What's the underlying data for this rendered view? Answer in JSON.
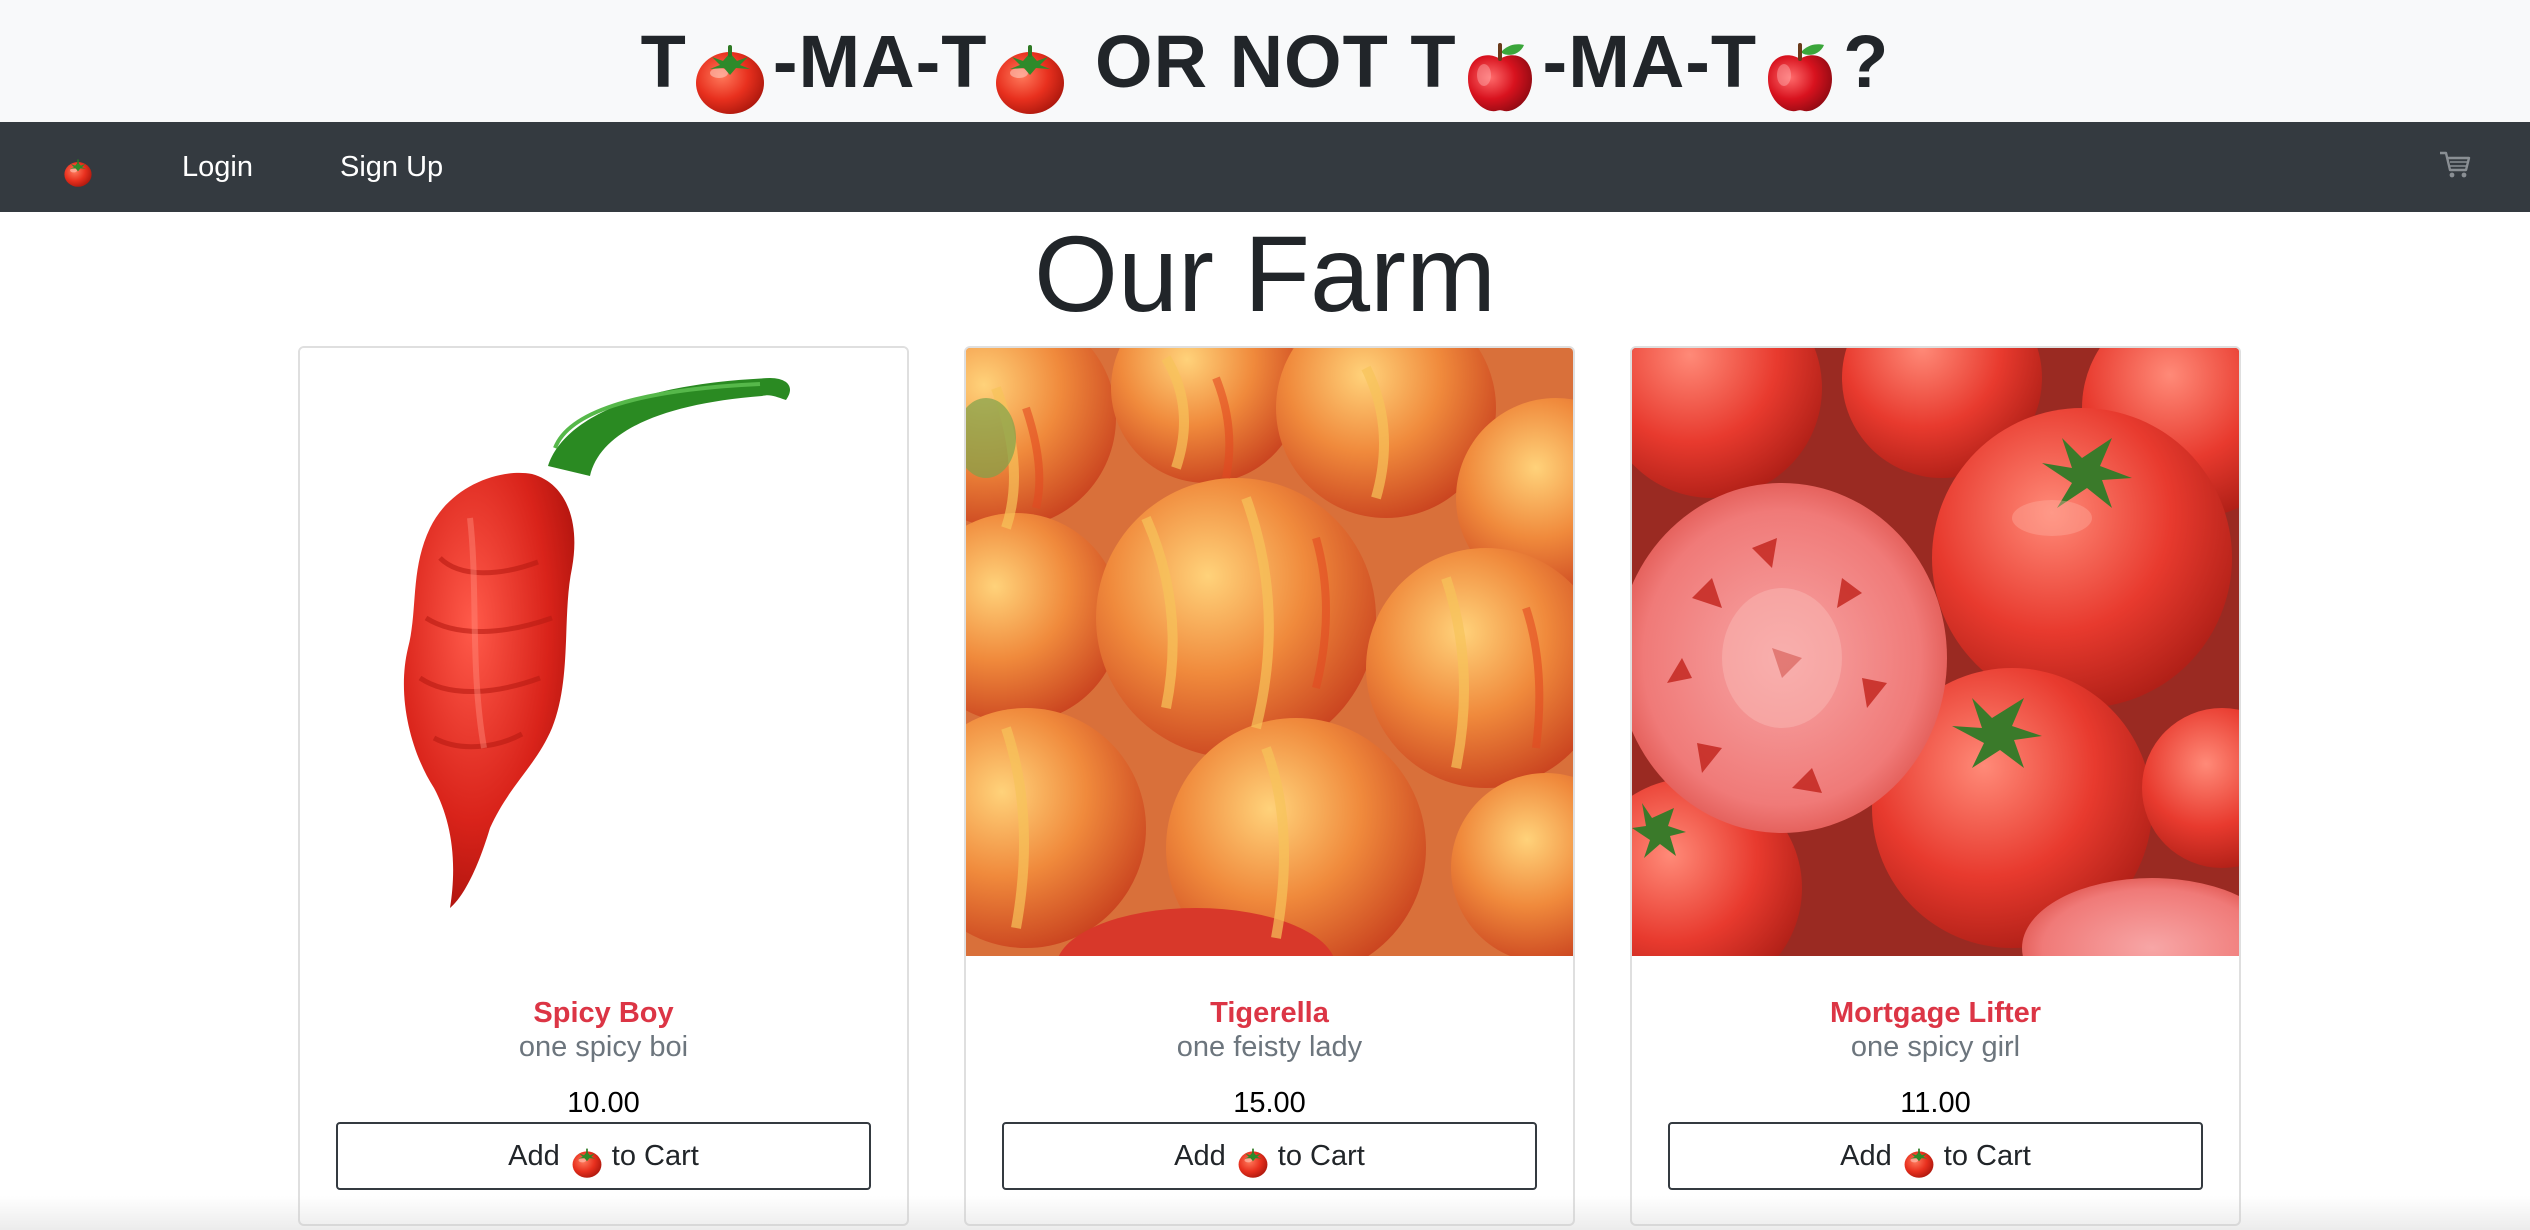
{
  "banner": {
    "parts": [
      "T",
      "-MA-T",
      " OR NOT T",
      "-MA-T",
      "?"
    ],
    "emoji_1": "tomato-emoji",
    "emoji_2": "tomato-emoji",
    "emoji_3": "red-apple-emoji",
    "emoji_4": "red-apple-emoji"
  },
  "navbar": {
    "brand_icon": "tomato-icon",
    "login_label": "Login",
    "signup_label": "Sign Up",
    "cart_icon": "shopping-cart-icon"
  },
  "page": {
    "title": "Our Farm"
  },
  "products": [
    {
      "name": "Spicy Boy",
      "description": "one spicy boi",
      "price": "10.00",
      "image": "carolina-reaper-pepper"
    },
    {
      "name": "Tigerella",
      "description": "one feisty lady",
      "price": "15.00",
      "image": "striped-tigerella-tomatoes"
    },
    {
      "name": "Mortgage Lifter",
      "description": "one spicy girl",
      "price": "11.00",
      "image": "sliced-heirloom-tomatoes"
    }
  ],
  "add_button": {
    "prefix": "Add",
    "icon": "tomato-icon",
    "suffix": "to Cart"
  },
  "colors": {
    "banner_bg": "#f8f9fa",
    "navbar_bg": "#343a40",
    "product_name": "#dc3545",
    "description": "#6c757d"
  }
}
